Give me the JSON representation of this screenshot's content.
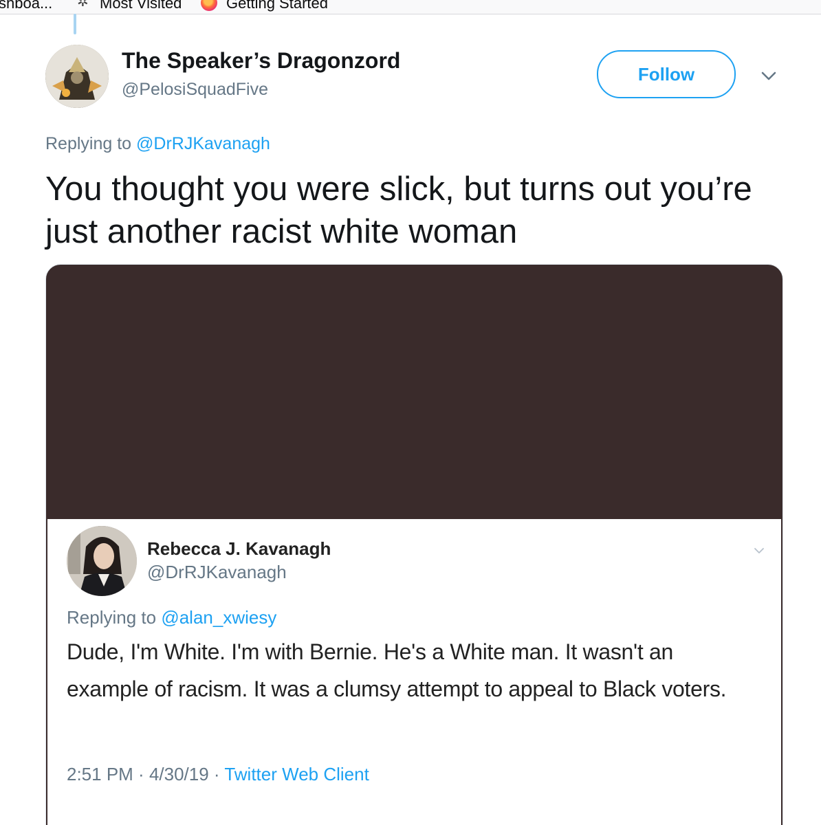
{
  "bookmarks": {
    "items": [
      {
        "label": "shboa..."
      },
      {
        "label": "Most Visited",
        "icon": "gear-icon"
      },
      {
        "label": "Getting Started",
        "icon": "firefox-icon"
      }
    ]
  },
  "tweet": {
    "display_name": "The Speaker’s Dragonzord",
    "handle": "@PelosiSquadFive",
    "follow_label": "Follow",
    "replying_prefix": "Replying to ",
    "replying_to": "@DrRJKavanagh",
    "text": "You thought you were slick, but turns out you’re just another racist white woman"
  },
  "quoted": {
    "display_name": "Rebecca J. Kavanagh",
    "handle": "@DrRJKavanagh",
    "replying_prefix": "Replying to ",
    "replying_to": "@alan_xwiesy",
    "text": "Dude, I'm White. I'm with Bernie. He's a White man. It wasn't an example of racism. It was a clumsy attempt to appeal to Black voters.",
    "time": "2:51 PM",
    "separator": " · ",
    "date": "4/30/19",
    "client": "Twitter Web Client"
  },
  "colors": {
    "accent": "#1da1f2",
    "media_bg": "#3a2b2b",
    "secondary_text": "#657786"
  }
}
